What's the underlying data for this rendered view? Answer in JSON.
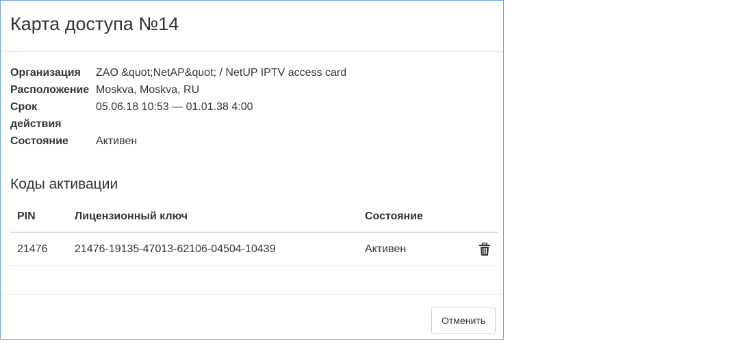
{
  "modal": {
    "title": "Карта доступа №14"
  },
  "info": [
    {
      "label": "Организация",
      "value": "ZAO &quot;NetAP&quot; / NetUP IPTV access card"
    },
    {
      "label": "Расположение",
      "value": "Moskva, Moskva, RU"
    },
    {
      "label": "Срок действия",
      "value": "05.06.18 10:53 — 01.01.38 4:00"
    },
    {
      "label": "Состояние",
      "value": "Активен"
    }
  ],
  "codes": {
    "title": "Коды активации",
    "headers": {
      "pin": "PIN",
      "key": "Лицензионный ключ",
      "status": "Состояние"
    },
    "rows": [
      {
        "pin": "21476",
        "key": "21476-19135-47013-62106-04504-10439",
        "status": "Активен",
        "action_icon": "trash-icon"
      }
    ]
  },
  "footer": {
    "cancel_label": "Отменить"
  }
}
